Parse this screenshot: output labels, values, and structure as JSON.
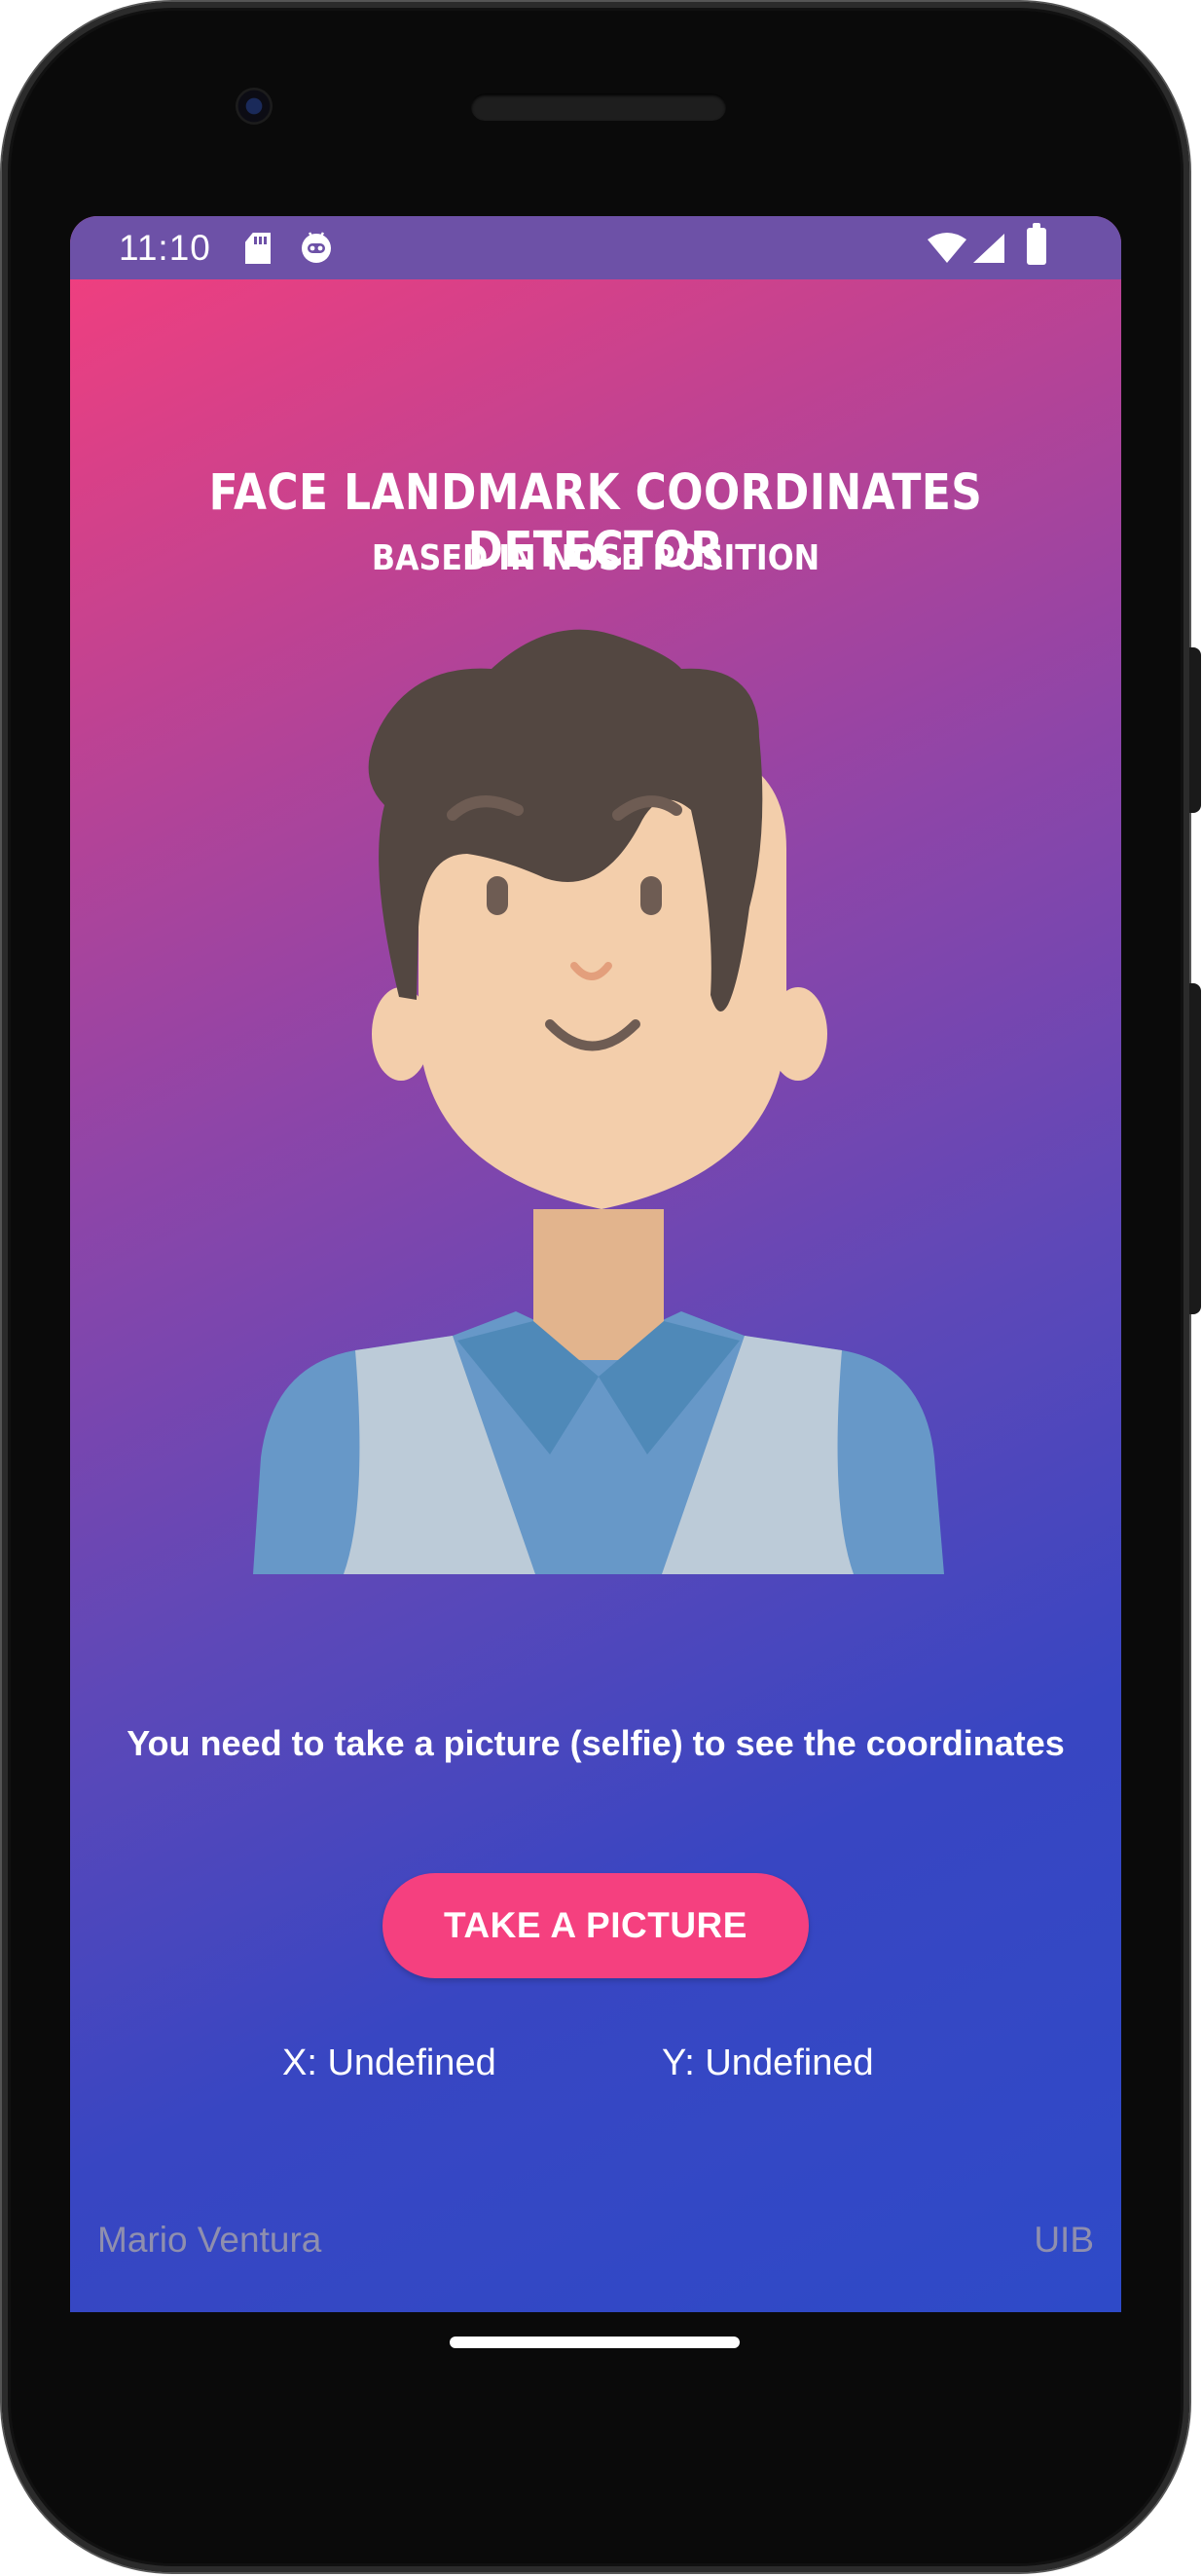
{
  "status_bar": {
    "time": "11:10",
    "icons": [
      "sd-card-icon",
      "robot-icon",
      "wifi-icon",
      "signal-icon",
      "battery-icon"
    ]
  },
  "app": {
    "title": "FACE LANDMARK COORDINATES DETECTOR",
    "subtitle": "BASED IN NOSE POSITION",
    "illustration": "avatar-man-illustration",
    "instruction": "You need to take a picture (selfie) to see the coordinates",
    "take_picture_label": "TAKE A PICTURE",
    "coordinates": {
      "x_label": "X: Undefined",
      "y_label": "Y: Undefined"
    },
    "footer": {
      "author": "Mario Ventura",
      "institution": "UIB"
    }
  },
  "colors": {
    "status_bar": "#6d51a7",
    "gradient_start": "#f53e7d",
    "gradient_end": "#2e4ac8",
    "button": "#f5407f",
    "footer_text": "#8f8fae"
  }
}
